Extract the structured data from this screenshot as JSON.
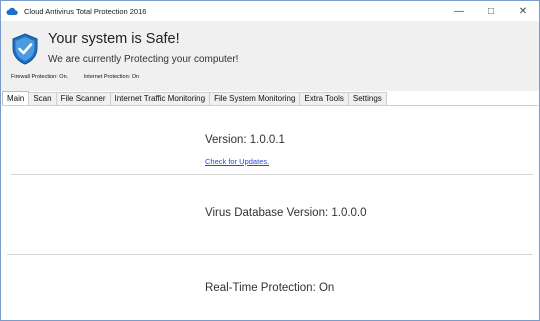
{
  "window": {
    "title": "Cloud Antivirus Total Protection 2016",
    "icon": "cloud-icon",
    "controls": [
      "minimize",
      "maximize",
      "close"
    ]
  },
  "header": {
    "icon": "shield-check-icon",
    "status_title": "Your system is Safe!",
    "status_subtitle": "We are currently Protecting your computer!",
    "firewall_protection": "Firewall Protection: On.",
    "internet_protection": "Internet Protection: On"
  },
  "tabs": [
    {
      "label": "Main",
      "active": true
    },
    {
      "label": "Scan",
      "active": false
    },
    {
      "label": "File Scanner",
      "active": false
    },
    {
      "label": "Internet Traffic Monitoring",
      "active": false
    },
    {
      "label": "File System Monitoring",
      "active": false
    },
    {
      "label": "Extra Tools",
      "active": false
    },
    {
      "label": "Settings",
      "active": false
    }
  ],
  "main": {
    "version": "Version: 1.0.0.1",
    "check_updates": "Check for Updates.",
    "virus_db_version": "Virus Database Version:  1.0.0.0",
    "realtime_protection": "Real-Time Protection: On"
  },
  "colors": {
    "accent": "#1f6fc5",
    "link": "#2a4bd7",
    "header_bg": "#f0f0f0"
  }
}
